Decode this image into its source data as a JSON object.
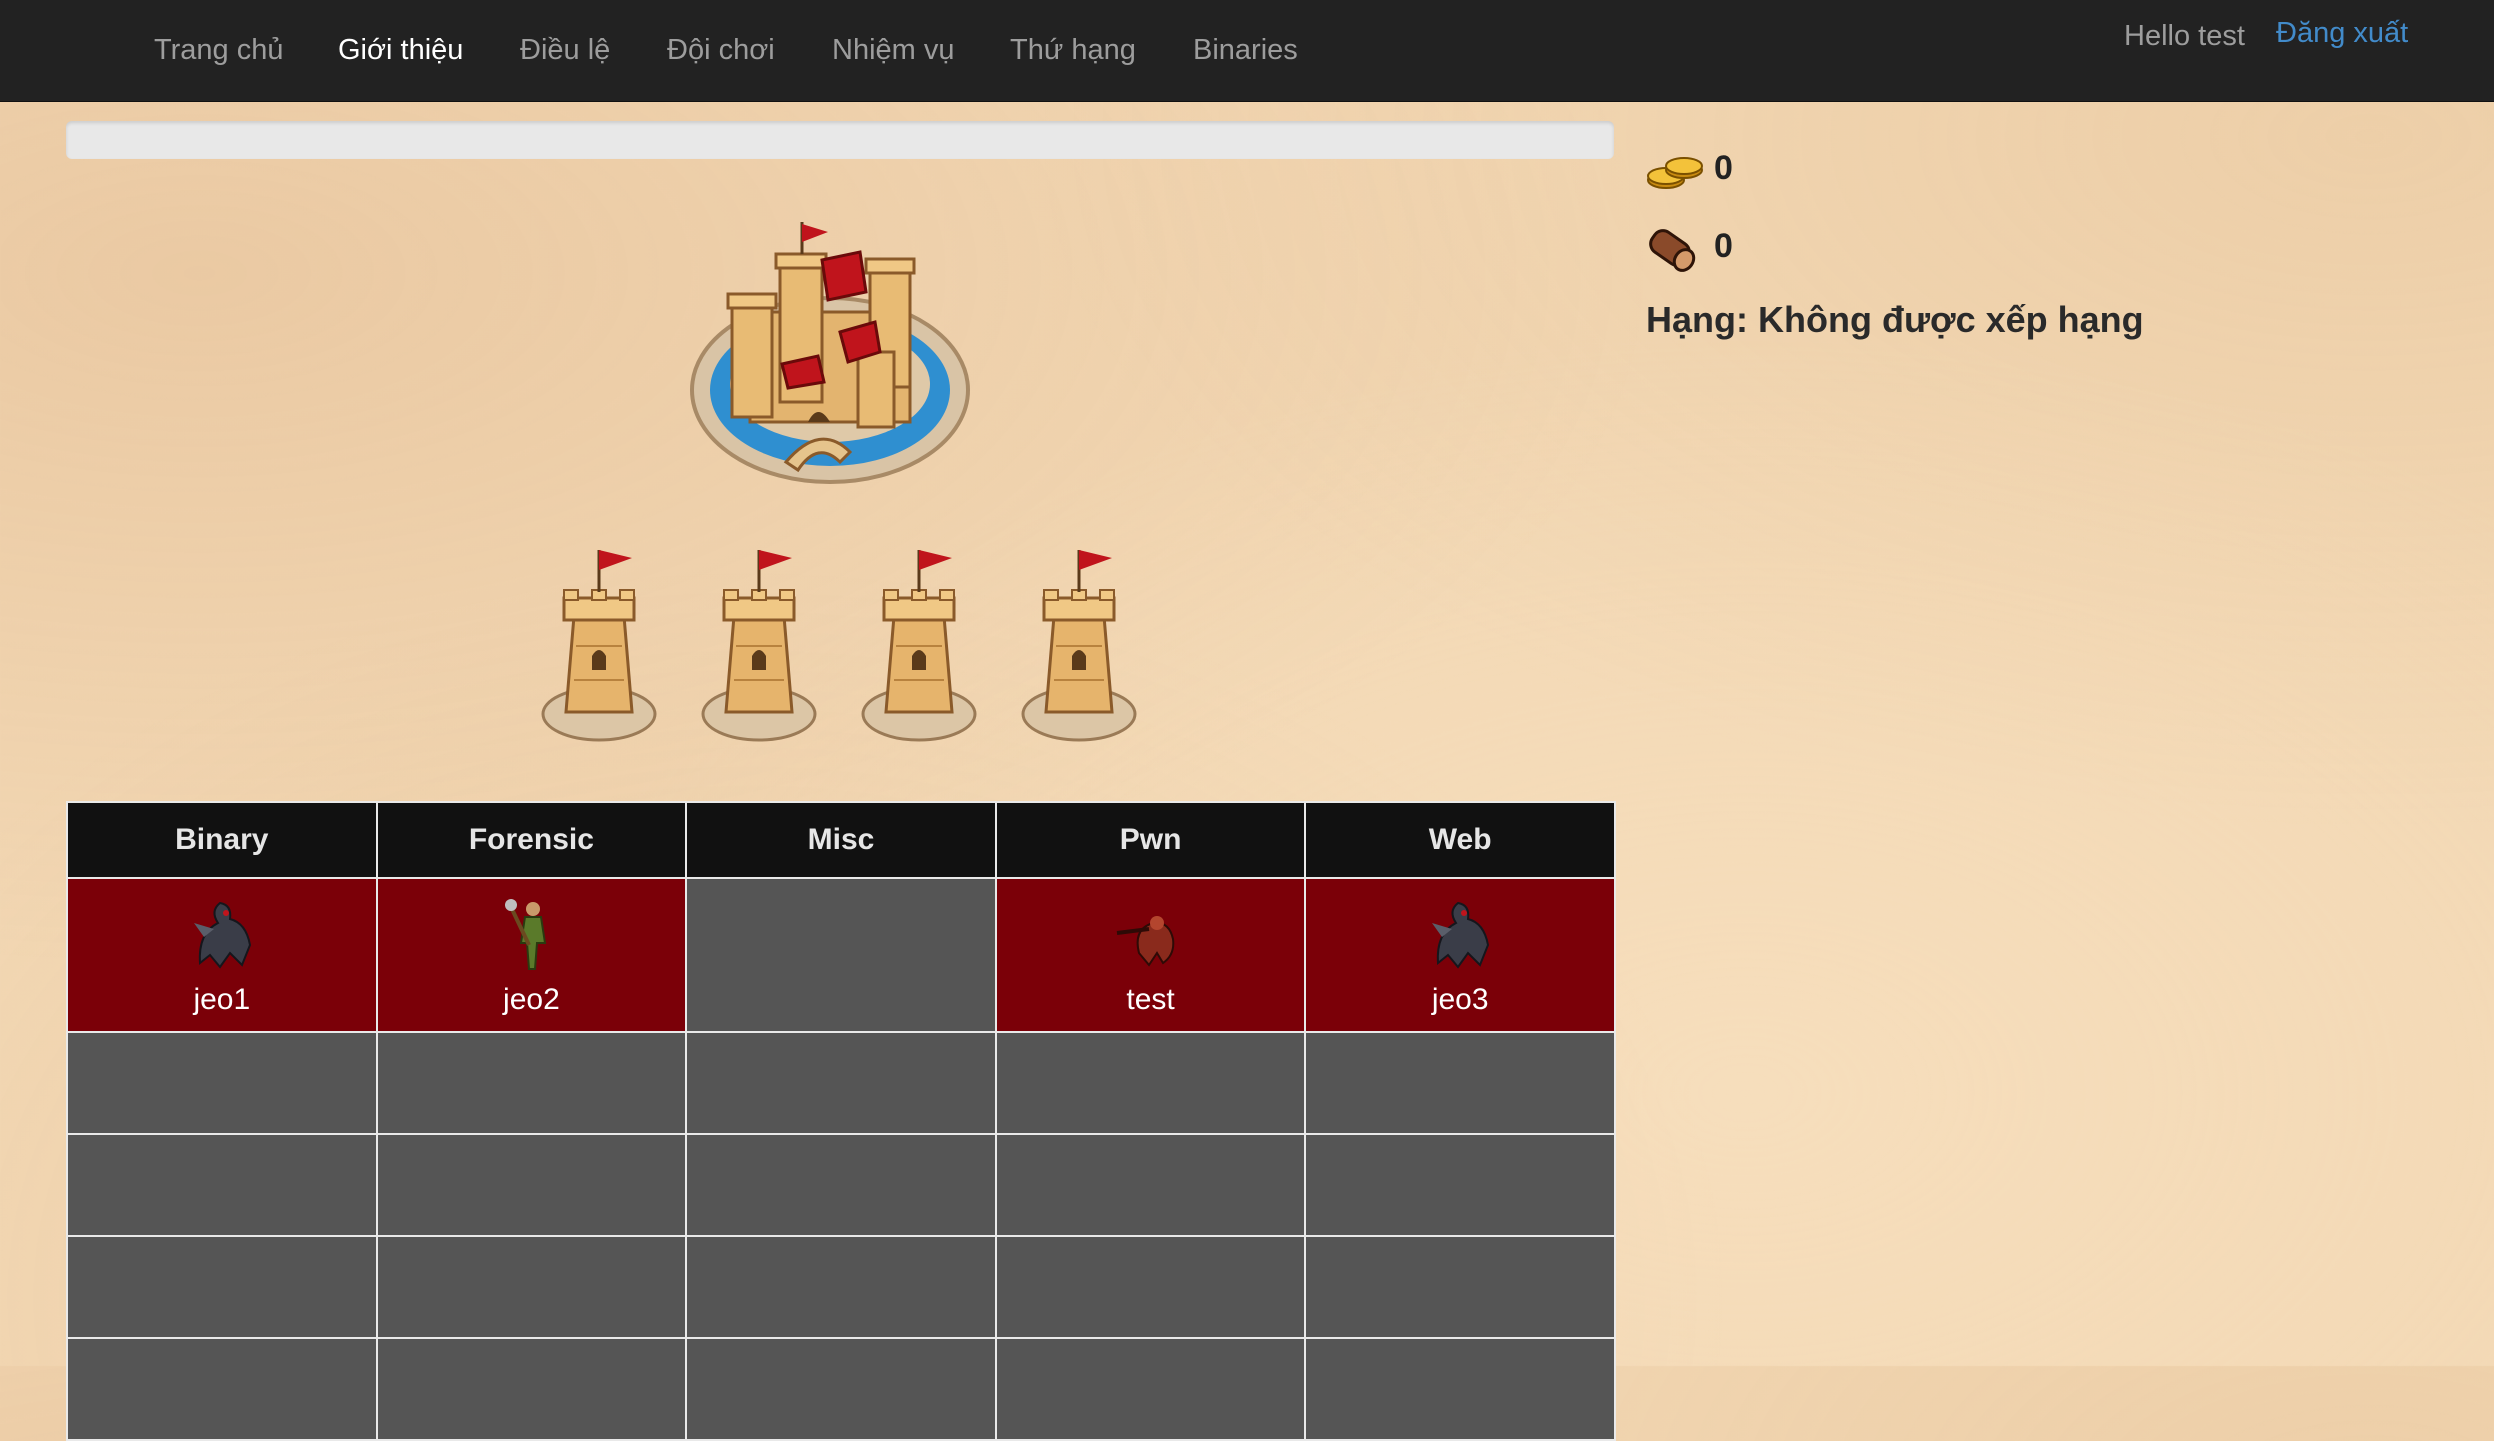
{
  "nav": {
    "items": [
      {
        "label": "Trang chủ"
      },
      {
        "label": "Giới thiệu",
        "active": true
      },
      {
        "label": "Điều lệ"
      },
      {
        "label": "Đội chơi"
      },
      {
        "label": "Nhiệm vụ"
      },
      {
        "label": "Thứ hạng"
      },
      {
        "label": "Binaries"
      }
    ],
    "greeting": "Hello test",
    "logout": "Đăng xuất"
  },
  "progress": {
    "value": 0
  },
  "stats": {
    "gold": "0",
    "wood": "0",
    "rank": "Hạng: Không được xếp hạng",
    "gold_icon": "gold-coins-icon",
    "wood_icon": "wood-log-icon"
  },
  "map": {
    "castle_icon": "castle-icon",
    "tower_icon": "tower-icon",
    "tower_count": 4
  },
  "board": {
    "columns": [
      "Binary",
      "Forensic",
      "Misc",
      "Pwn",
      "Web"
    ],
    "row1": [
      {
        "label": "jeo1",
        "owned": true,
        "icon": "dark-creature-icon"
      },
      {
        "label": "jeo2",
        "owned": true,
        "icon": "warrior-icon"
      },
      {
        "label": "",
        "owned": false,
        "icon": ""
      },
      {
        "label": "test",
        "owned": true,
        "icon": "red-creature-icon"
      },
      {
        "label": "jeo3",
        "owned": true,
        "icon": "dark-creature-icon"
      }
    ]
  },
  "colors": {
    "navbar": "#222222",
    "owned_cell": "#7b0008",
    "empty_cell": "#555555",
    "header_cell": "#111111",
    "link": "#428bca"
  }
}
